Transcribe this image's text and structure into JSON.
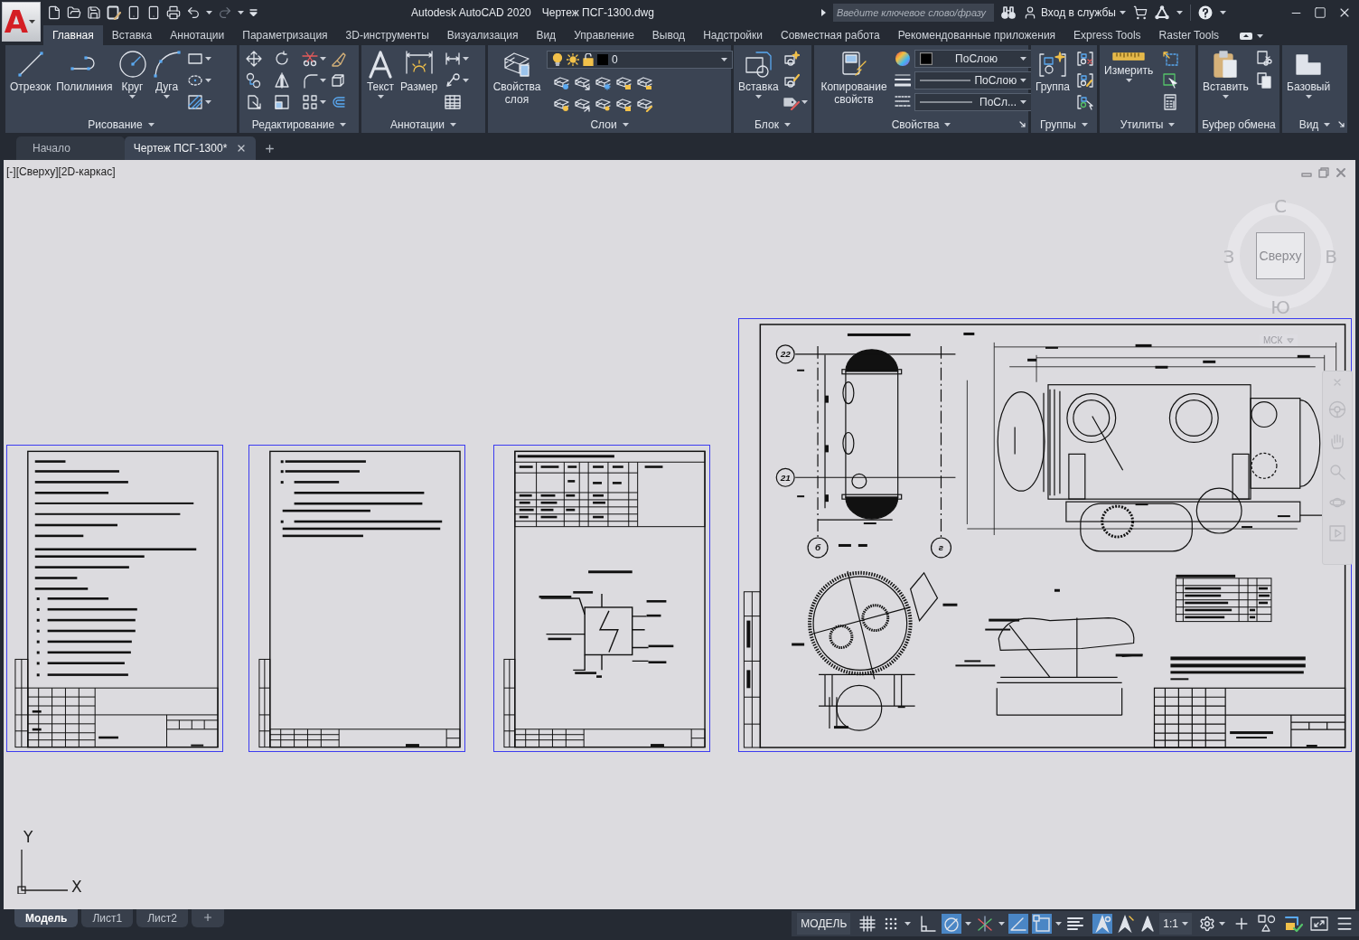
{
  "app_menu": {
    "logo": "A"
  },
  "history": {
    "undo": {
      "disabled": false
    },
    "redo": {
      "disabled": true
    }
  },
  "window": {
    "title": "Autodesk AutoCAD 2020",
    "document": "Чертеж ПСГ-1300.dwg"
  },
  "search": {
    "placeholder": "Введите ключевое слово/фразу"
  },
  "account": {
    "label": "Вход в службы"
  },
  "ribbon_tabs": [
    {
      "label": "Главная",
      "selected": true
    },
    {
      "label": "Вставка",
      "selected": false
    },
    {
      "label": "Аннотации",
      "selected": false
    },
    {
      "label": "Параметризация",
      "selected": false
    },
    {
      "label": "3D-инструменты",
      "selected": false
    },
    {
      "label": "Визуализация",
      "selected": false
    },
    {
      "label": "Вид",
      "selected": false
    },
    {
      "label": "Управление",
      "selected": false
    },
    {
      "label": "Вывод",
      "selected": false
    },
    {
      "label": "Надстройки",
      "selected": false
    },
    {
      "label": "Совместная работа",
      "selected": false
    },
    {
      "label": "Рекомендованные приложения",
      "selected": false
    },
    {
      "label": "Express Tools",
      "selected": false
    },
    {
      "label": "Raster Tools",
      "selected": false
    }
  ],
  "ribbon_panels": [
    {
      "kind": "draw",
      "title": "Рисование",
      "menu": true,
      "launcher": false,
      "buttons": [
        {
          "label": "Отрезок",
          "dropdown": false
        },
        {
          "label": "Полилиния",
          "dropdown": false
        },
        {
          "label": "Круг",
          "dropdown": true
        },
        {
          "label": "Дуга",
          "dropdown": true
        }
      ]
    },
    {
      "kind": "modify",
      "title": "Редактирование",
      "menu": true,
      "launcher": false
    },
    {
      "kind": "annotation",
      "title": "Аннотации",
      "menu": true,
      "launcher": false,
      "buttons": [
        {
          "label": "Текст",
          "dropdown": true
        },
        {
          "label": "Размер",
          "dropdown": false
        }
      ]
    },
    {
      "kind": "layers",
      "title": "Слои",
      "menu": true,
      "launcher": false,
      "buttons": [
        {
          "label": "Свойства слоя",
          "dropdown": false
        }
      ],
      "current_layer": "0"
    },
    {
      "kind": "block",
      "title": "Блок",
      "menu": true,
      "launcher": false,
      "buttons": [
        {
          "label": "Вставка",
          "dropdown": true
        }
      ]
    },
    {
      "kind": "properties",
      "title": "Свойства",
      "menu": true,
      "launcher": true,
      "buttons": [
        {
          "label": "Копирование свойств",
          "dropdown": false
        }
      ],
      "color_setting": "ПоСлою",
      "lineweight_setting": "ПоСлою",
      "linetype_setting": "ПоСл..."
    },
    {
      "kind": "groups",
      "title": "Группы",
      "menu": true,
      "launcher": false,
      "buttons": [
        {
          "label": "Группа",
          "dropdown": false
        }
      ]
    },
    {
      "kind": "utilities",
      "title": "Утилиты",
      "menu": true,
      "launcher": false,
      "buttons": [
        {
          "label": "Измерить",
          "dropdown": true
        }
      ]
    },
    {
      "kind": "clipboard",
      "title": "Буфер обмена",
      "menu": false,
      "launcher": false,
      "buttons": [
        {
          "label": "Вставить",
          "dropdown": true
        }
      ]
    },
    {
      "kind": "view",
      "title": "Вид",
      "menu": true,
      "launcher": true,
      "buttons": [
        {
          "label": "Базовый",
          "dropdown": true
        }
      ]
    }
  ],
  "file_tabs": [
    {
      "label": "Начало",
      "selected": false
    },
    {
      "label": "Чертеж ПСГ-1300*",
      "selected": true
    }
  ],
  "viewport": {
    "controls": [
      "[-]",
      "[Сверху]",
      "[2D-каркас]"
    ]
  },
  "viewcube": {
    "face": "Сверху",
    "north": "С",
    "west": "З",
    "east": "В",
    "south": "Ю"
  },
  "ucs_menu": {
    "label": "МСК"
  },
  "sheets": [
    {
      "kind": "text_first_page",
      "selected": true
    },
    {
      "kind": "text_page",
      "selected": true
    },
    {
      "kind": "schematic_page",
      "selected": true
    },
    {
      "kind": "assembly_drawing",
      "selected": true,
      "callouts": [
        "22",
        "21",
        "б",
        "г"
      ]
    }
  ],
  "ucs_icon": {
    "x": "X",
    "y": "Y"
  },
  "layout_tabs": [
    {
      "label": "Модель",
      "selected": true
    },
    {
      "label": "Лист1",
      "selected": false
    },
    {
      "label": "Лист2",
      "selected": false
    }
  ],
  "status_bar": {
    "space": "МОДЕЛЬ",
    "annotation_scale": "1:1",
    "toggles": [
      {
        "on": false
      },
      {
        "on": false
      },
      {
        "on": false
      },
      {
        "on": true
      },
      {
        "on": false
      },
      {
        "on": true
      },
      {
        "on": true
      },
      {
        "on": false
      },
      {
        "on": true
      },
      {
        "on": false
      }
    ]
  }
}
